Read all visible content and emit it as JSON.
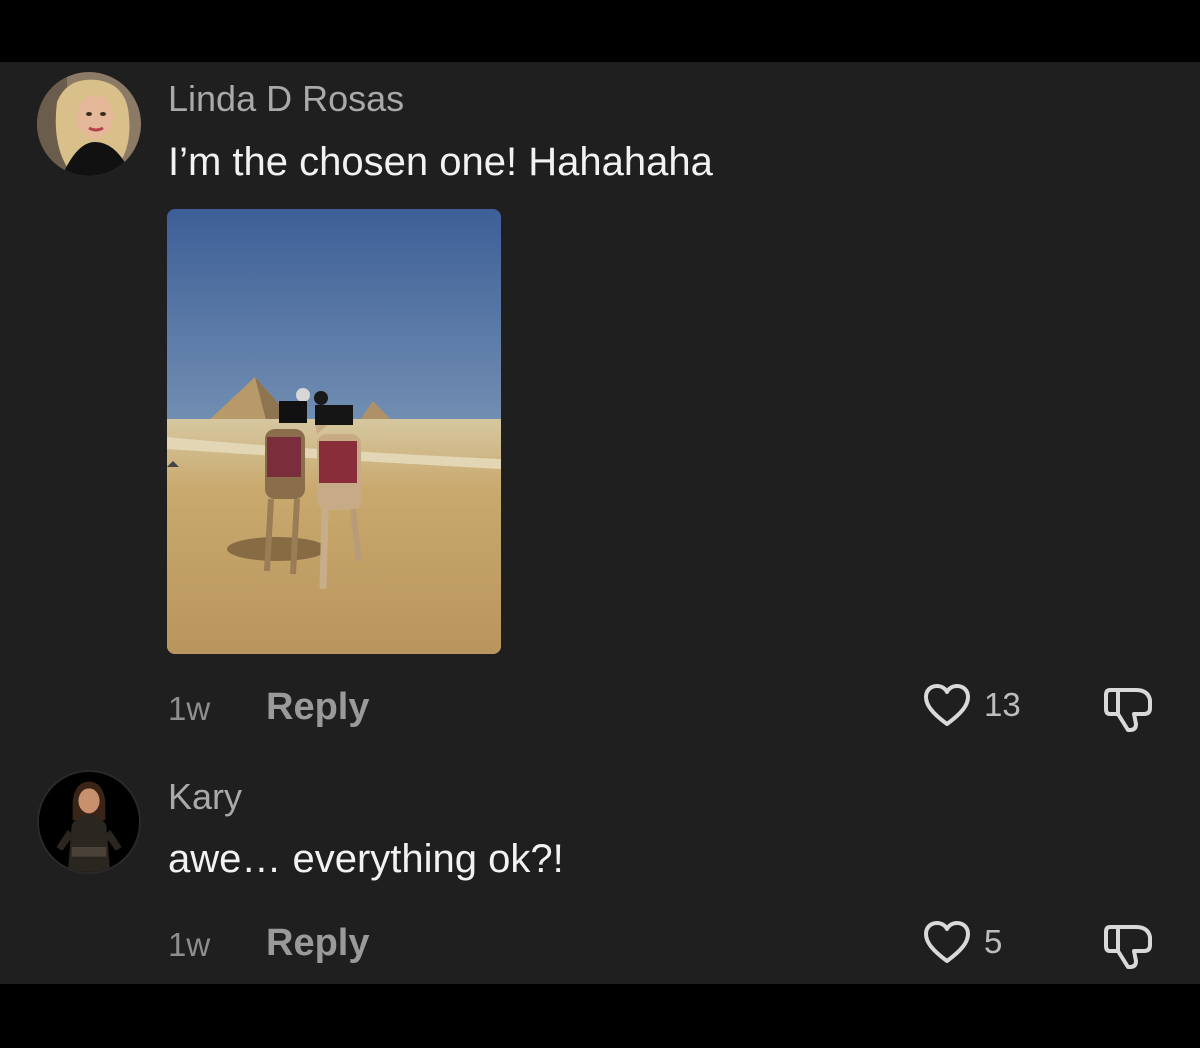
{
  "comments": [
    {
      "username": "Linda D Rosas",
      "text": "I’m the chosen one! Hahahaha",
      "time": "1w",
      "reply_label": "Reply",
      "likes": "13",
      "has_image": true,
      "avatar": "avatar-woman-blonde"
    },
    {
      "username": "Kary",
      "text": "awe… everything ok?!",
      "time": "1w",
      "reply_label": "Reply",
      "likes": "5",
      "has_image": false,
      "avatar": "avatar-woman-dark-outfit"
    }
  ],
  "icons": {
    "like": "heart-outline-icon",
    "dislike": "thumbs-down-outline-icon"
  },
  "colors": {
    "background": "#1f1f1f",
    "letterbox": "#000000",
    "username": "#a9a9a9",
    "text": "#f2f2f2",
    "meta": "#8e8e8e"
  }
}
